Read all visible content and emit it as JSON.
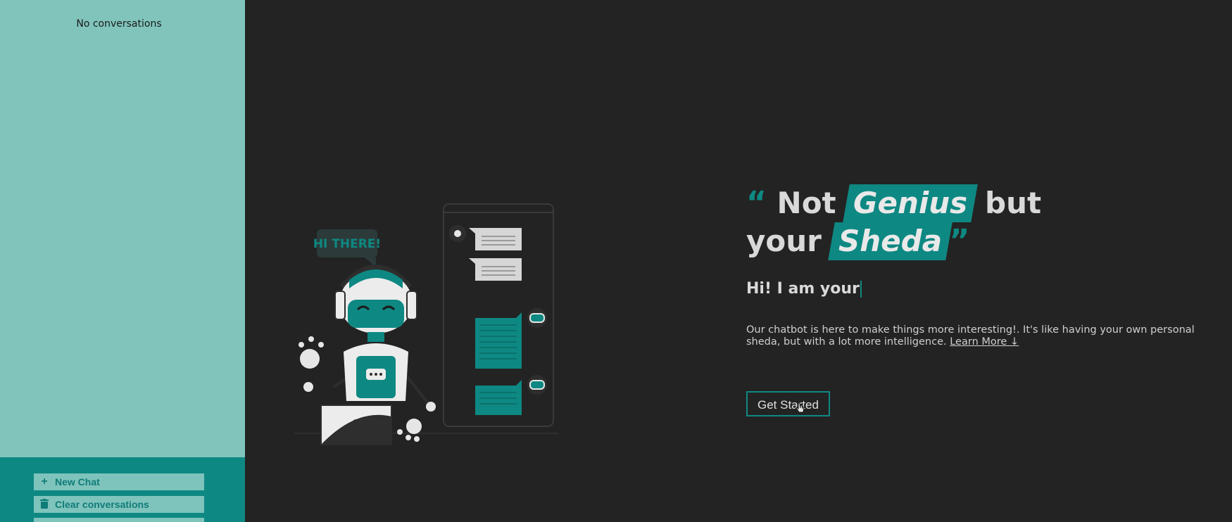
{
  "sidebar": {
    "empty_text": "No conversations",
    "buttons": {
      "new_chat": "New Chat",
      "clear": "Clear conversations"
    }
  },
  "illustration": {
    "bubble_text": "HI THERE!"
  },
  "hero": {
    "quote_open": "“",
    "headline_1": "Not",
    "highlight_1": "Genius",
    "headline_2": "but",
    "headline_3": "your",
    "highlight_2": "Sheda",
    "quote_close": "”",
    "typing_text": "Hi! I am your",
    "description": "Our chatbot is here to make things more interesting!. It's like having your own personal sheda, but with a lot more intelligence.",
    "learn_more": "Learn More ↓",
    "cta_label": "Get Started"
  },
  "colors": {
    "accent": "#0e8882",
    "sidebar_bg": "#80c4bc",
    "page_bg": "#232323"
  }
}
